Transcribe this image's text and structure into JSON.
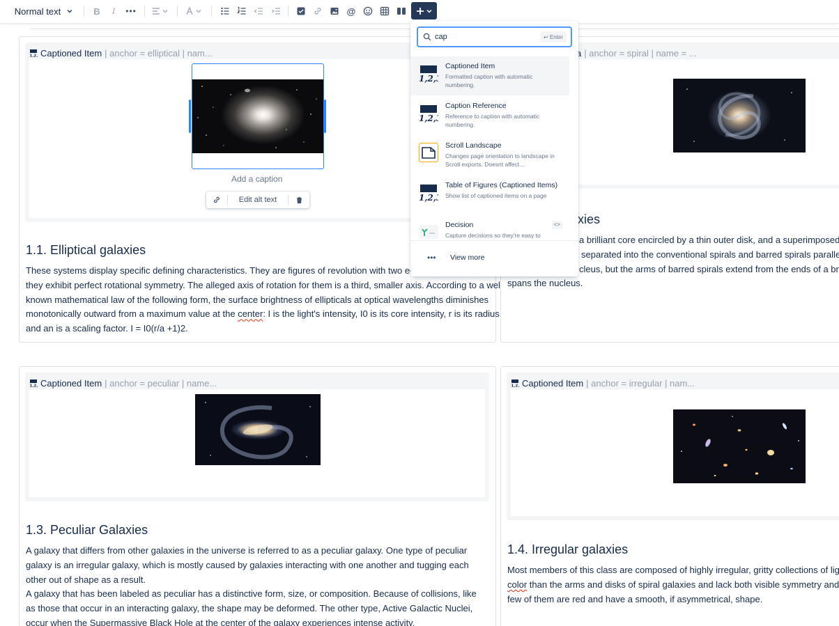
{
  "toolbar": {
    "text_style": "Normal text",
    "buttons": [
      "bold-icon",
      "italic-icon",
      "more-formatting-icon",
      "align-icon",
      "text-color-icon",
      "bullet-list-icon",
      "numbered-list-icon",
      "outdent-icon",
      "indent-icon",
      "action-item-icon",
      "link-icon",
      "image-icon",
      "mention-icon",
      "emoji-icon",
      "table-icon",
      "layouts-icon",
      "insert-plus-icon"
    ]
  },
  "insert_menu": {
    "search_value": "cap",
    "enter_hint": "↩ Enter",
    "items": [
      {
        "title": "Captioned Item",
        "description": "Formatted caption with automatic numbering.",
        "icon": "caption-numbering-icon"
      },
      {
        "title": "Caption Reference",
        "description": "Reference to caption with automatic numbering.",
        "icon": "caption-numbering-icon"
      },
      {
        "title": "Scroll Landscape",
        "description": "Changes page orientation to landscape in Scroll exports. Doesnt affect…",
        "icon": "landscape-page-icon"
      },
      {
        "title": "Table of Figures (Captioned Items)",
        "description": "Show list of captioned items on a page",
        "icon": "caption-numbering-icon"
      },
      {
        "title": "Decision",
        "description": "Capture decisions so they're easy to",
        "icon": "decision-icon",
        "shortcut": "<>"
      }
    ],
    "view_more": "View more"
  },
  "captions": {
    "elliptical": {
      "title": "Captioned Item",
      "meta": "| anchor = elliptical | nam..."
    },
    "spiral": {
      "title": "a",
      "meta": "| anchor = spiral | name = ..."
    },
    "peculiar": {
      "title": "Captioned Item",
      "meta": "| anchor = peculiar | name..."
    },
    "irregular": {
      "title": "Captioned Item",
      "meta": "| anchor = irregular | nam..."
    }
  },
  "image_tools": {
    "add_caption_placeholder": "Add a caption",
    "edit_alt_text": "Edit alt text"
  },
  "sections": {
    "elliptical": {
      "heading": "1.1. Elliptical galaxies",
      "text_a": "These systems display specific defining characteristics. They are figures of revolution with two equal p",
      "text_b": "they exhibit perfect rotational symmetry. The alleged axis of rotation for them is a third, smaller axis. According to a well-",
      "text_c": "known mathematical law of the following form, the surface brightness of ellipticals at optical wavelengths diminishes",
      "text_d1": "monotonically outward from a maximum value at the ",
      "text_d_spell": "center",
      "text_d2": ": I is the light's intensity, I0 is its core intensity, r is its radius,",
      "text_e": "and an is a scaling factor. I = I0(r/a +1)2."
    },
    "spiral": {
      "heading_partial": "axies",
      "line_a": "a brilliant core encircled by a thin outer disk, and a superimposed spi",
      "line_b": "separated into the conventional spirals and barred spirals parallel cla",
      "line_c": "cleus, but the arms of barred spirals extend from the ends of a bright,",
      "line_d": "spans the nucleus."
    },
    "peculiar": {
      "heading": "1.3. Peculiar Galaxies",
      "p1": "A galaxy that differs from other galaxies in the universe is referred to as a peculiar galaxy. One type of peculiar galaxy is an irregular galaxy, which is mostly caused by galaxies interacting with one another and tugging each other out of shape as a result.",
      "p2": "A galaxy that has been labeled as peculiar has a distinctive form, size, or composition. Because of collisions, like as those that occur in an interacting galaxy, the shape may be deformed. The other type, Active Galactic Nuclei, occur when the Supermassive Black Hole at the center of the galaxy experiences intense activity."
    },
    "irregular": {
      "heading": "1.4. Irregular galaxies",
      "line_a": "Most members of this class are composed of highly irregular, gritty collections of light pa",
      "line_b_spell": "color",
      "line_b": " than the arms and disks of spiral galaxies and lack both visible symmetry and a clea",
      "line_c": "few of them are red and have a smooth, if asymmetrical, shape."
    }
  }
}
